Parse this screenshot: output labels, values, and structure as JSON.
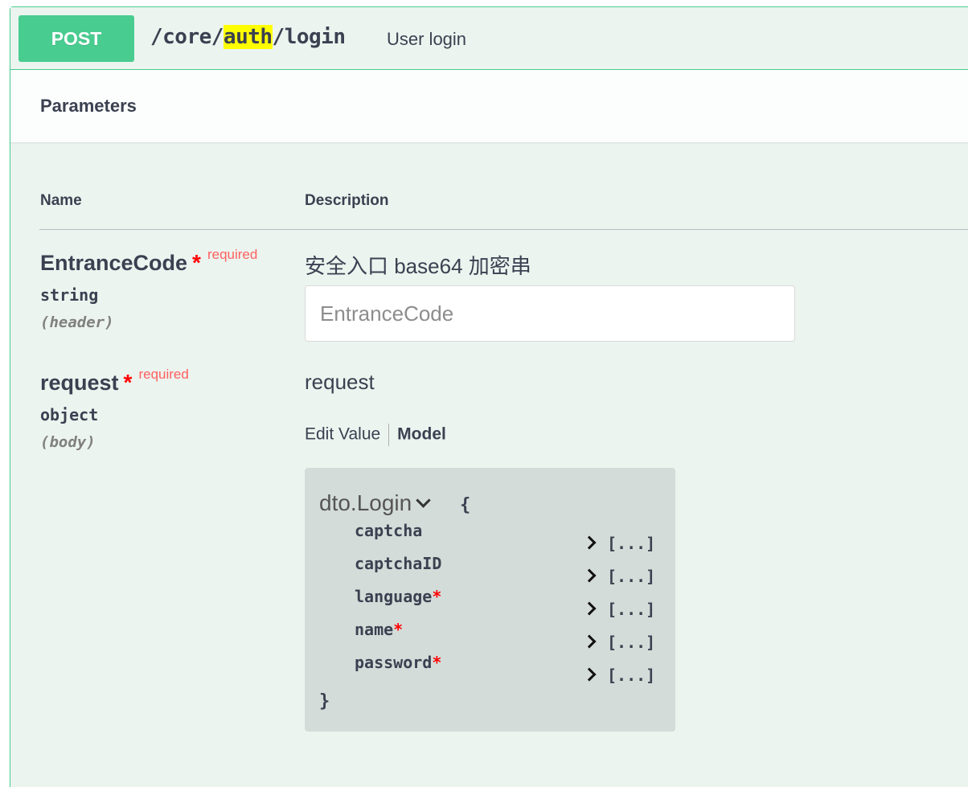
{
  "operation": {
    "method": "POST",
    "path_prefix": "/core/",
    "path_highlight": "auth",
    "path_suffix": "/login",
    "summary": "User login"
  },
  "parameters": {
    "section_title": "Parameters",
    "col_name": "Name",
    "col_description": "Description",
    "required_label": "required",
    "required_star": "*",
    "items": [
      {
        "name": "EntranceCode",
        "type": "string",
        "in": "(header)",
        "description": "安全入口 base64 加密串",
        "placeholder": "EntranceCode"
      },
      {
        "name": "request",
        "type": "object",
        "in": "(body)",
        "description": "request",
        "tabs": [
          "Edit Value",
          "Model"
        ],
        "active_tab": "Model",
        "model": {
          "title": "dto.Login",
          "open_brace": "{",
          "close_brace": "}",
          "expand_label": "[...]",
          "properties": [
            {
              "name": "captcha",
              "required": false
            },
            {
              "name": "captchaID",
              "required": false
            },
            {
              "name": "language",
              "required": true
            },
            {
              "name": "name",
              "required": true
            },
            {
              "name": "password",
              "required": true
            }
          ]
        }
      }
    ]
  },
  "colors": {
    "post_green": "#49cc90",
    "post_bg": "#ecf4ef",
    "highlight": "#ffff00",
    "required_red": "#ff0000"
  }
}
